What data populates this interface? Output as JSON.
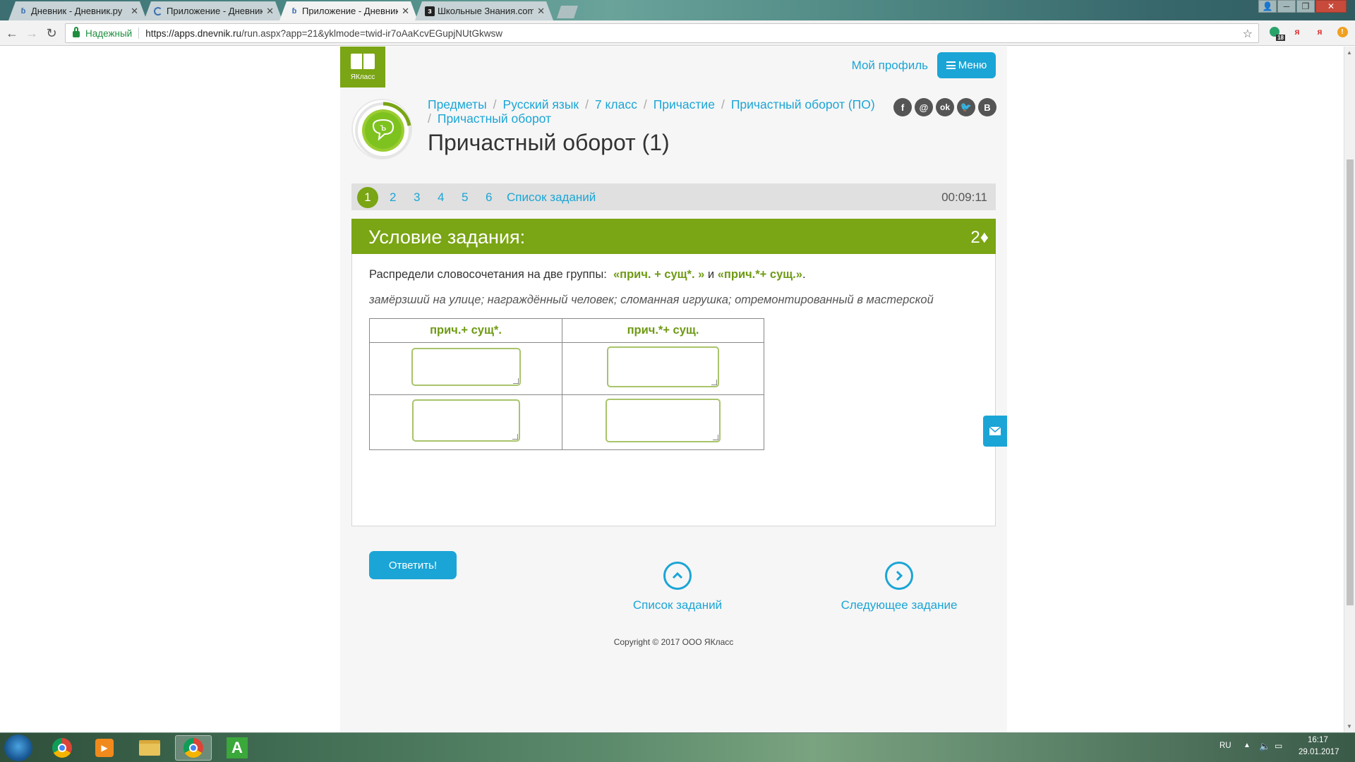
{
  "browser": {
    "tabs": [
      {
        "label": "Дневник - Дневник.ру",
        "icon": "dnevnik-icon"
      },
      {
        "label": "Приложение - Дневник",
        "icon": "loading-icon"
      },
      {
        "label": "Приложение - Дневник",
        "icon": "dnevnik-icon"
      },
      {
        "label": "Школьные Знания.com",
        "icon": "znanija-icon"
      }
    ],
    "secure_label": "Надежный",
    "url_host": "https://apps.dnevnik.ru",
    "url_path": "/run.aspx?app=21&yklmode=twid-ir7oAaKcvEGupjNUtGkwsw",
    "ext_badge": "18"
  },
  "header": {
    "logo_text": "ЯКласс",
    "profile_link": "Мой профиль",
    "menu_label": "Меню"
  },
  "breadcrumbs": [
    "Предметы",
    "Русский язык",
    "7 класс",
    "Причастие",
    "Причастный оборот (ПО)",
    "Причастный оборот"
  ],
  "page_title": "Причастный оборот (1)",
  "social": [
    "f",
    "@",
    "ok",
    "tw",
    "B"
  ],
  "task_nav": {
    "numbers": [
      "1",
      "2",
      "3",
      "4",
      "5",
      "6"
    ],
    "active": "1",
    "list_label": "Список заданий",
    "timer": "00:09:11"
  },
  "condition": {
    "title": "Условие задания:",
    "points": "2♦",
    "instruction_prefix": "Распредели словосочетания на две группы:",
    "group1_quoted": "«прич. + сущ*. »",
    "conj": "и",
    "group2_quoted": "«прич.*+ сущ.»",
    "phrases": "замёрзший на улице; награждённый человек; сломанная игрушка; отремонтированный в мастерской",
    "table_headers": [
      "прич.+ сущ*.",
      "прич.*+ сущ."
    ],
    "answer_button": "Ответить!"
  },
  "footer": {
    "list_link": "Список заданий",
    "next_link": "Следующее задание",
    "copyright": "Copyright © 2017 ООО ЯКласс"
  },
  "taskbar": {
    "lang": "RU",
    "time": "16:17",
    "date": "29.01.2017"
  },
  "colors": {
    "green": "#7aa514",
    "blue": "#1ba5d6"
  }
}
